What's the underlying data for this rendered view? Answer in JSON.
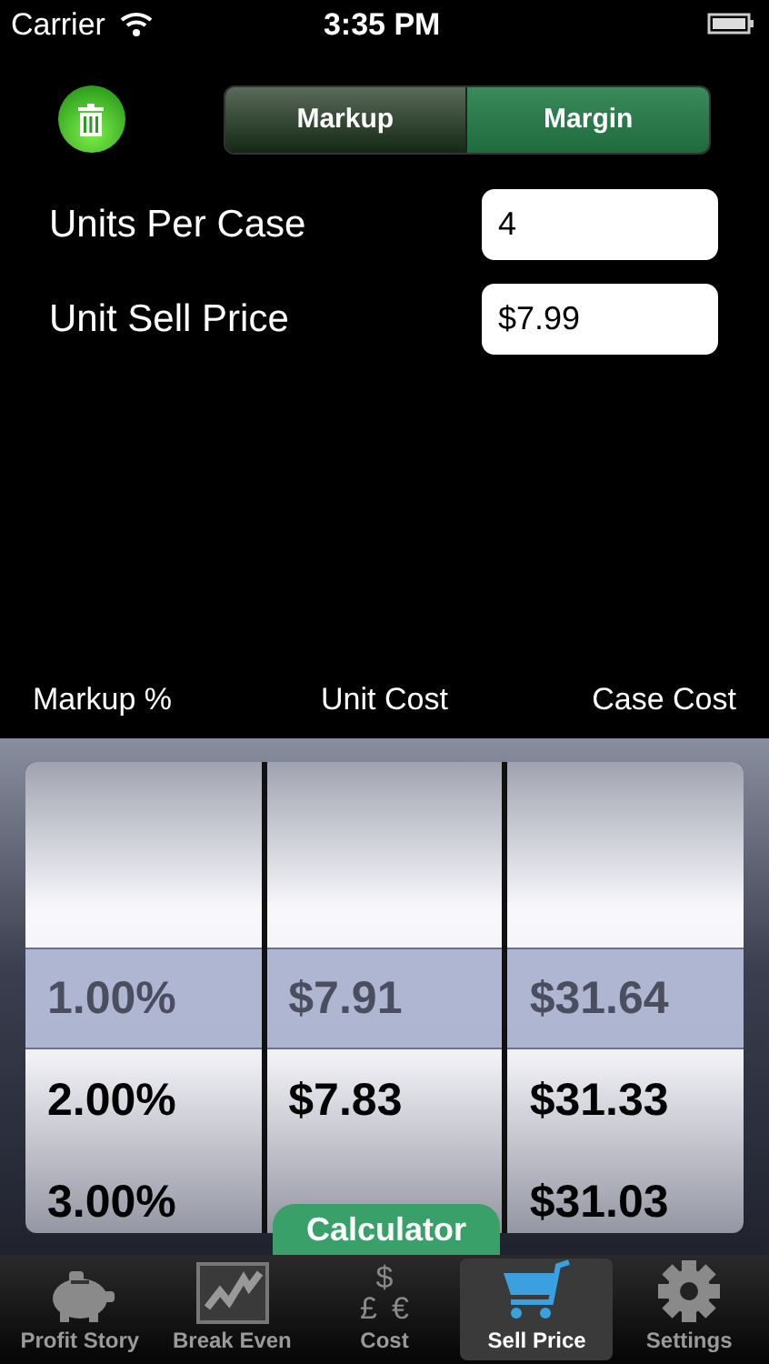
{
  "status_bar": {
    "carrier": "Carrier",
    "time": "3:35 PM"
  },
  "mode_toggle": [
    {
      "label": "Markup",
      "selected": false
    },
    {
      "label": "Margin",
      "selected": true
    }
  ],
  "fields": [
    {
      "label": "Units Per Case",
      "value": "4"
    },
    {
      "label": "Unit Sell Price",
      "value": "$7.99"
    }
  ],
  "picker": {
    "columns": [
      "Markup %",
      "Unit Cost",
      "Case Cost"
    ],
    "rows": [
      {
        "cells": [
          "1.00%",
          "$7.91",
          "$31.64"
        ],
        "selected": true
      },
      {
        "cells": [
          "2.00%",
          "$7.83",
          "$31.33"
        ],
        "selected": false
      },
      {
        "cells": [
          "3.00%",
          null,
          "$31.03"
        ],
        "selected": false
      }
    ]
  },
  "calculator_tab": "Calculator",
  "tab_bar": [
    {
      "label": "Profit Story",
      "kind": "piggy",
      "selected": false
    },
    {
      "label": "Break Even",
      "kind": "chart",
      "selected": false
    },
    {
      "label": "Cost",
      "kind": "currency",
      "glyphs": [
        "$",
        "£",
        "€"
      ],
      "selected": false
    },
    {
      "label": "Sell Price",
      "kind": "cart",
      "selected": true
    },
    {
      "label": "Settings",
      "kind": "gear",
      "selected": false
    }
  ]
}
